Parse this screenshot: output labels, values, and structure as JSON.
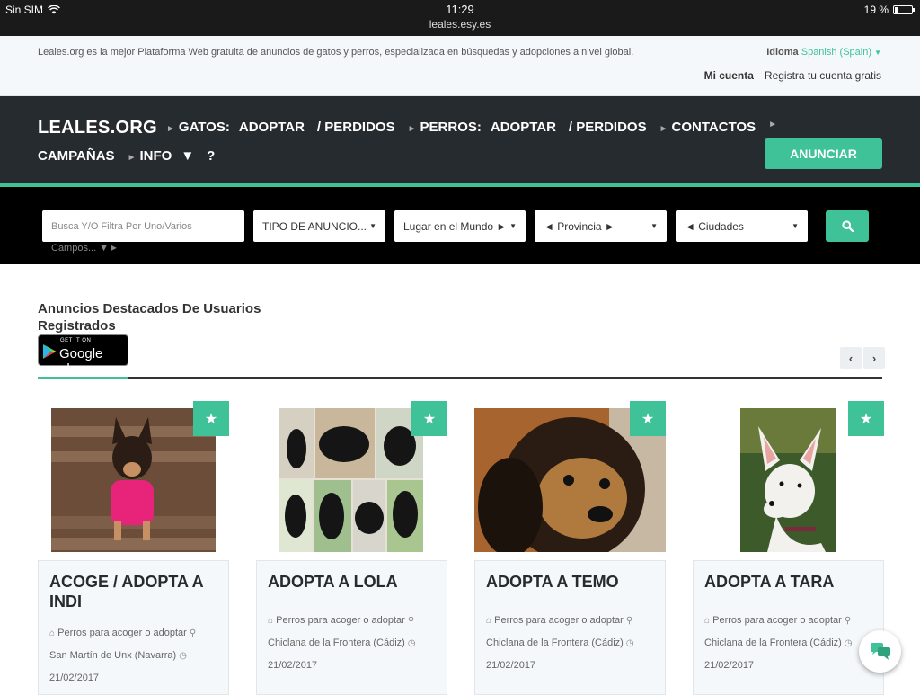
{
  "statusbar": {
    "carrier": "Sin SIM",
    "time": "11:29",
    "url": "leales.esy.es",
    "battery": "19 %",
    "battery_level": 0.19
  },
  "topbar": {
    "tagline": "Leales.org es la mejor Plataforma Web gratuita de anuncios de gatos y perros, especializada en búsquedas y adopciones a nivel global.",
    "language_label": "Idioma",
    "language_value": "Spanish (Spain)",
    "my_account": "Mi cuenta",
    "register": "Registra tu cuenta gratis"
  },
  "navbar": {
    "logo": "LEALES.ORG",
    "items": [
      "GATOS:",
      "ADOPTAR",
      "/ PERDIDOS",
      "PERROS:",
      "ADOPTAR",
      "/ PERDIDOS",
      "CONTACTOS",
      "CAMPAÑAS",
      "INFO",
      "▼",
      "?"
    ],
    "cta": "ANUNCIAR"
  },
  "search": {
    "placeholder": "Busca Y/O Filtra Por Uno/Varios",
    "hint": "Campos... ▼►",
    "filters": [
      "TIPO DE ANUNCIO...",
      "Lugar en el Mundo ►",
      "◄ Provincia ►",
      "◄ Ciudades"
    ]
  },
  "featured": {
    "title": "Anuncios Destacados De Usuarios Registrados",
    "gplay_small": "GET IT ON",
    "gplay_big": "Google play"
  },
  "cards": [
    {
      "title": "ACOGE / ADOPTA A INDI",
      "category": "Perros para acoger o adoptar",
      "location": "San Martín de Unx (Navarra)",
      "date": "21/02/2017"
    },
    {
      "title": "ADOPTA A LOLA",
      "category": "Perros para acoger o adoptar",
      "location": "Chiclana de la Frontera (Cádiz)",
      "date": "21/02/2017"
    },
    {
      "title": "ADOPTA A TEMO",
      "category": "Perros para acoger o adoptar",
      "location": "Chiclana de la Frontera (Cádiz)",
      "date": "21/02/2017"
    },
    {
      "title": "ADOPTA A TARA",
      "category": "Perros para acoger o adoptar",
      "location": "Chiclana de la Frontera (Cádiz)",
      "date": "21/02/2017"
    }
  ],
  "icons": {
    "star": "star-icon",
    "home": "home-icon",
    "pin": "map-pin-icon",
    "clock": "clock-icon",
    "search": "search-icon",
    "chat": "chat-icon"
  },
  "colors": {
    "accent": "#3fc297",
    "dark": "#262b30"
  }
}
